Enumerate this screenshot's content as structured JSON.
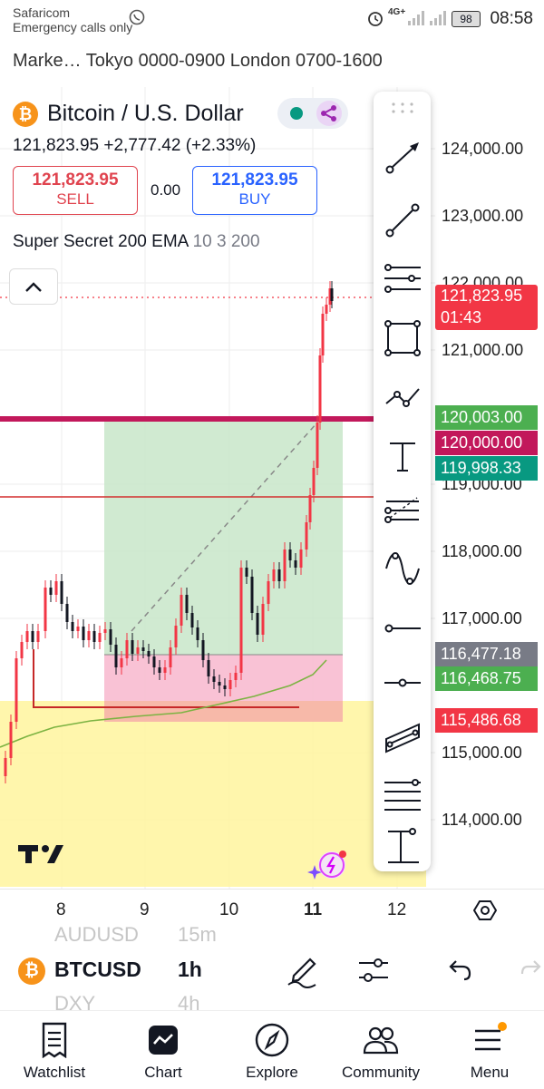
{
  "status_bar": {
    "carrier": "Safaricom",
    "emergency": "Emergency calls only",
    "network": "4G+",
    "battery": "98",
    "time": "08:58"
  },
  "market_hours": "Marke…  Tokyo 0000-0900 London 0700-1600",
  "symbol": {
    "name": "Bitcoin / U.S. Dollar",
    "icon": "bitcoin-icon",
    "price_line": "121,823.95  +2,777.42 (+2.33%)",
    "sell_value": "121,823.95",
    "sell_label": "SELL",
    "spread": "0.00",
    "buy_value": "121,823.95",
    "buy_label": "BUY"
  },
  "indicator": {
    "name": "Super Secret 200 EMA",
    "params": "10 3 200"
  },
  "price_axis": {
    "labels": [
      "124,000.00",
      "123,000.00",
      "122,000.00",
      "121,000.00",
      "119,000.00",
      "118,000.00",
      "117,000.00",
      "115,000.00",
      "114,000.00"
    ]
  },
  "price_tags": [
    {
      "text": "121,823.95",
      "sub": "01:43",
      "color": "#f23645"
    },
    {
      "text": "120,003.00",
      "color": "#4caf50"
    },
    {
      "text": "120,000.00",
      "color": "#c2185b"
    },
    {
      "text": "119,998.33",
      "color": "#089981"
    },
    {
      "text": "116,477.18",
      "color": "#787b86"
    },
    {
      "text": "116,468.75",
      "color": "#4caf50"
    },
    {
      "text": "115,486.68",
      "color": "#f23645"
    }
  ],
  "x_axis": {
    "labels": [
      "8",
      "9",
      "10",
      "11",
      "12"
    ]
  },
  "draw_tools": [
    "arrow-line-icon",
    "trend-line-icon",
    "fib-retracement-icon",
    "rectangle-icon",
    "path-icon",
    "text-icon",
    "pitchfork-icon",
    "sine-wave-icon",
    "horizontal-ray-icon",
    "horizontal-line-icon",
    "parallel-channel-icon",
    "multi-line-icon",
    "measure-icon"
  ],
  "bottom_toolbar": {
    "symbol": "BTCUSD",
    "interval": "1h",
    "ghost_prev_symbol": "AUDUSD",
    "ghost_prev_interval": "15m",
    "ghost_next_symbol": "DXY",
    "ghost_next_interval": "4h"
  },
  "nav": {
    "items": [
      {
        "label": "Watchlist",
        "icon": "watchlist-icon"
      },
      {
        "label": "Chart",
        "icon": "chart-icon"
      },
      {
        "label": "Explore",
        "icon": "compass-icon"
      },
      {
        "label": "Community",
        "icon": "community-icon"
      },
      {
        "label": "Menu",
        "icon": "menu-icon"
      }
    ]
  },
  "colors": {
    "up": "#f23645",
    "down": "#131722",
    "profit_zone": "#c8e6c9",
    "loss_zone": "#f8bbd0",
    "yellow_zone": "#fff59d",
    "accent": "#2962ff"
  }
}
